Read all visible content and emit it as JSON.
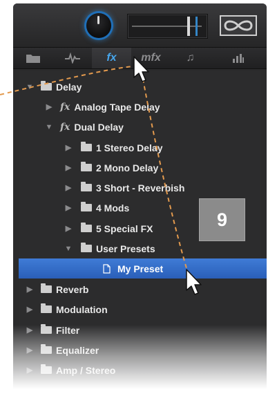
{
  "tabs": [
    {
      "label": "",
      "icon": "folder-icon"
    },
    {
      "label": "",
      "icon": "waveform-icon"
    },
    {
      "label": "fx",
      "icon": "fx-icon",
      "active": true
    },
    {
      "label": "mfx",
      "icon": "mfx-icon"
    },
    {
      "label": "♫",
      "icon": "music-note-icon"
    },
    {
      "label": "",
      "icon": "bar-chart-icon"
    }
  ],
  "tree": {
    "items": [
      {
        "label": "Delay",
        "type": "folder",
        "expanded": true
      },
      {
        "label": "Analog Tape Delay",
        "type": "fx",
        "expanded": false
      },
      {
        "label": "Dual Delay",
        "type": "fx",
        "expanded": true
      },
      {
        "label": "1 Stereo Delay",
        "type": "folder",
        "expanded": false
      },
      {
        "label": "2 Mono Delay",
        "type": "folder",
        "expanded": false
      },
      {
        "label": "3 Short - Reverbish",
        "type": "folder",
        "expanded": false
      },
      {
        "label": "4 Mods",
        "type": "folder",
        "expanded": false
      },
      {
        "label": "5 Special FX",
        "type": "folder",
        "expanded": false
      },
      {
        "label": "User Presets",
        "type": "folder",
        "expanded": true
      },
      {
        "label": "My Preset",
        "type": "file",
        "selected": true
      },
      {
        "label": "Reverb",
        "type": "folder",
        "expanded": false
      },
      {
        "label": "Modulation",
        "type": "folder",
        "expanded": false
      },
      {
        "label": "Filter",
        "type": "folder",
        "expanded": false
      },
      {
        "label": "Equalizer",
        "type": "folder",
        "expanded": false
      },
      {
        "label": "Amp / Stereo",
        "type": "folder",
        "expanded": false
      }
    ]
  },
  "step_badge": "9",
  "colors": {
    "accent": "#47a6ec",
    "selection": "#3a72cf",
    "annotation": "#e39a4e"
  }
}
